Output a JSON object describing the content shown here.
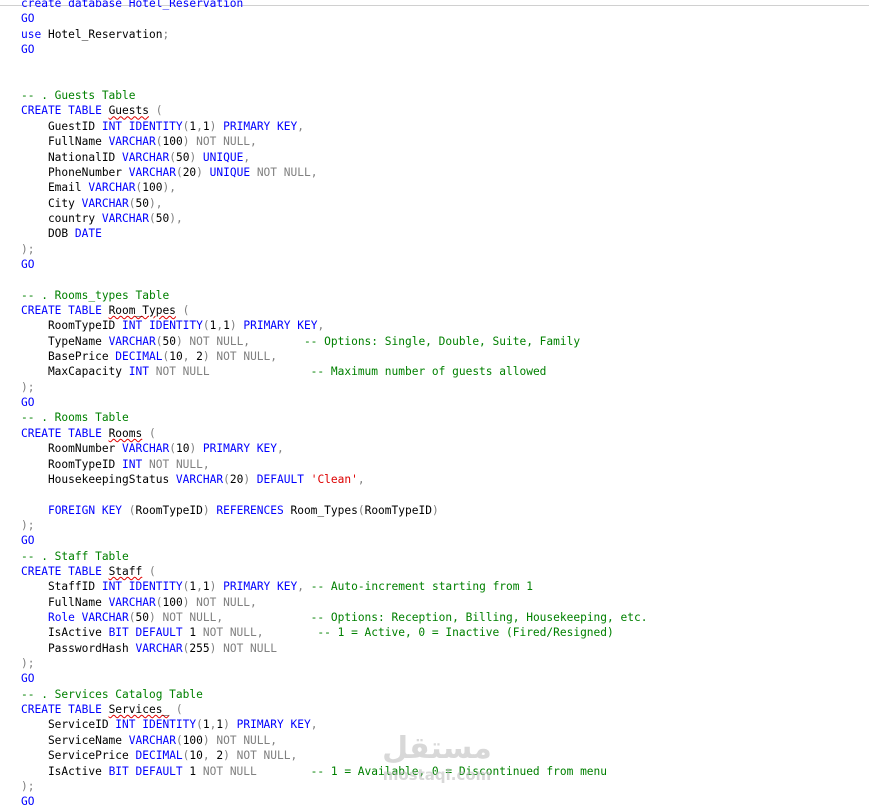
{
  "colors": {
    "keyword": "#0000ff",
    "comment": "#008000",
    "string": "#dd0000",
    "operator": "#808080",
    "identifier": "#000000",
    "squiggle": "#e00000"
  },
  "editor": {
    "lines": [
      [
        [
          "kw",
          "create database Hotel_Reservation"
        ]
      ],
      [
        [
          "kw",
          "GO"
        ]
      ],
      [
        [
          "kw",
          "use"
        ],
        [
          "id",
          " Hotel_Reservation"
        ],
        [
          "op",
          ";"
        ]
      ],
      [
        [
          "kw",
          "GO"
        ]
      ],
      [],
      [],
      [
        [
          "cm",
          "-- . Guests Table"
        ]
      ],
      [
        [
          "kw",
          "CREATE TABLE "
        ],
        [
          "bad",
          "Guests"
        ],
        [
          "op",
          " ("
        ]
      ],
      [
        [
          "id",
          "    GuestID "
        ],
        [
          "kw",
          "INT IDENTITY"
        ],
        [
          "op",
          "("
        ],
        [
          "id",
          "1"
        ],
        [
          "op",
          ","
        ],
        [
          "id",
          "1"
        ],
        [
          "op",
          ") "
        ],
        [
          "kw",
          "PRIMARY KEY"
        ],
        [
          "op",
          ","
        ]
      ],
      [
        [
          "id",
          "    FullName "
        ],
        [
          "kw",
          "VARCHAR"
        ],
        [
          "op",
          "("
        ],
        [
          "id",
          "100"
        ],
        [
          "op",
          ") NOT NULL,"
        ]
      ],
      [
        [
          "id",
          "    NationalID "
        ],
        [
          "kw",
          "VARCHAR"
        ],
        [
          "op",
          "("
        ],
        [
          "id",
          "50"
        ],
        [
          "op",
          ") "
        ],
        [
          "kw",
          "UNIQUE"
        ],
        [
          "op",
          ","
        ]
      ],
      [
        [
          "id",
          "    PhoneNumber "
        ],
        [
          "kw",
          "VARCHAR"
        ],
        [
          "op",
          "("
        ],
        [
          "id",
          "20"
        ],
        [
          "op",
          ") "
        ],
        [
          "kw",
          "UNIQUE"
        ],
        [
          "op",
          " NOT NULL,"
        ]
      ],
      [
        [
          "id",
          "    Email "
        ],
        [
          "kw",
          "VARCHAR"
        ],
        [
          "op",
          "("
        ],
        [
          "id",
          "100"
        ],
        [
          "op",
          "),"
        ]
      ],
      [
        [
          "id",
          "    City "
        ],
        [
          "kw",
          "VARCHAR"
        ],
        [
          "op",
          "("
        ],
        [
          "id",
          "50"
        ],
        [
          "op",
          "),"
        ]
      ],
      [
        [
          "id",
          "    country "
        ],
        [
          "kw",
          "VARCHAR"
        ],
        [
          "op",
          "("
        ],
        [
          "id",
          "50"
        ],
        [
          "op",
          "),"
        ]
      ],
      [
        [
          "id",
          "    DOB "
        ],
        [
          "kw",
          "DATE"
        ]
      ],
      [
        [
          "op",
          ");"
        ]
      ],
      [
        [
          "kw",
          "GO"
        ]
      ],
      [],
      [
        [
          "cm",
          "-- . Rooms_types Table"
        ]
      ],
      [
        [
          "kw",
          "CREATE TABLE "
        ],
        [
          "bad",
          "Room_Types"
        ],
        [
          "op",
          " ("
        ]
      ],
      [
        [
          "id",
          "    RoomTypeID "
        ],
        [
          "kw",
          "INT IDENTITY"
        ],
        [
          "op",
          "("
        ],
        [
          "id",
          "1"
        ],
        [
          "op",
          ","
        ],
        [
          "id",
          "1"
        ],
        [
          "op",
          ") "
        ],
        [
          "kw",
          "PRIMARY KEY"
        ],
        [
          "op",
          ","
        ]
      ],
      [
        [
          "id",
          "    TypeName "
        ],
        [
          "kw",
          "VARCHAR"
        ],
        [
          "op",
          "("
        ],
        [
          "id",
          "50"
        ],
        [
          "op",
          ") NOT NULL,"
        ],
        [
          "id",
          "        "
        ],
        [
          "cm",
          "-- Options: Single, Double, Suite, Family"
        ]
      ],
      [
        [
          "id",
          "    BasePrice "
        ],
        [
          "kw",
          "DECIMAL"
        ],
        [
          "op",
          "("
        ],
        [
          "id",
          "10"
        ],
        [
          "op",
          ", "
        ],
        [
          "id",
          "2"
        ],
        [
          "op",
          ") NOT NULL,"
        ]
      ],
      [
        [
          "id",
          "    MaxCapacity "
        ],
        [
          "kw",
          "INT"
        ],
        [
          "op",
          " NOT NULL"
        ],
        [
          "id",
          "               "
        ],
        [
          "cm",
          "-- Maximum number of guests allowed"
        ]
      ],
      [
        [
          "op",
          ");"
        ]
      ],
      [
        [
          "kw",
          "GO"
        ]
      ],
      [
        [
          "cm",
          "-- . Rooms Table"
        ]
      ],
      [
        [
          "kw",
          "CREATE TABLE "
        ],
        [
          "bad",
          "Rooms"
        ],
        [
          "op",
          " ("
        ]
      ],
      [
        [
          "id",
          "    RoomNumber "
        ],
        [
          "kw",
          "VARCHAR"
        ],
        [
          "op",
          "("
        ],
        [
          "id",
          "10"
        ],
        [
          "op",
          ") "
        ],
        [
          "kw",
          "PRIMARY KEY"
        ],
        [
          "op",
          ","
        ]
      ],
      [
        [
          "id",
          "    RoomTypeID "
        ],
        [
          "kw",
          "INT"
        ],
        [
          "op",
          " NOT NULL,"
        ]
      ],
      [
        [
          "id",
          "    HousekeepingStatus "
        ],
        [
          "kw",
          "VARCHAR"
        ],
        [
          "op",
          "("
        ],
        [
          "id",
          "20"
        ],
        [
          "op",
          ") "
        ],
        [
          "kw",
          "DEFAULT"
        ],
        [
          "id",
          " "
        ],
        [
          "str",
          "'Clean'"
        ],
        [
          "op",
          ","
        ]
      ],
      [],
      [
        [
          "id",
          "    "
        ],
        [
          "kw",
          "FOREIGN KEY"
        ],
        [
          "op",
          " ("
        ],
        [
          "id",
          "RoomTypeID"
        ],
        [
          "op",
          ") "
        ],
        [
          "kw",
          "REFERENCES"
        ],
        [
          "id",
          " Room_Types"
        ],
        [
          "op",
          "("
        ],
        [
          "id",
          "RoomTypeID"
        ],
        [
          "op",
          ")"
        ]
      ],
      [
        [
          "op",
          ");"
        ]
      ],
      [
        [
          "kw",
          "GO"
        ]
      ],
      [
        [
          "cm",
          "-- . Staff Table"
        ]
      ],
      [
        [
          "kw",
          "CREATE TABLE "
        ],
        [
          "bad",
          "Staff"
        ],
        [
          "op",
          " ("
        ]
      ],
      [
        [
          "id",
          "    StaffID "
        ],
        [
          "kw",
          "INT IDENTITY"
        ],
        [
          "op",
          "("
        ],
        [
          "id",
          "1"
        ],
        [
          "op",
          ","
        ],
        [
          "id",
          "1"
        ],
        [
          "op",
          ") "
        ],
        [
          "kw",
          "PRIMARY KEY"
        ],
        [
          "op",
          ", "
        ],
        [
          "cm",
          "-- Auto-increment starting from 1"
        ]
      ],
      [
        [
          "id",
          "    FullName "
        ],
        [
          "kw",
          "VARCHAR"
        ],
        [
          "op",
          "("
        ],
        [
          "id",
          "100"
        ],
        [
          "op",
          ") NOT NULL,"
        ]
      ],
      [
        [
          "id",
          "    "
        ],
        [
          "kw",
          "Role VARCHAR"
        ],
        [
          "op",
          "("
        ],
        [
          "id",
          "50"
        ],
        [
          "op",
          ") NOT NULL,"
        ],
        [
          "id",
          "             "
        ],
        [
          "cm",
          "-- Options: Reception, Billing, Housekeeping, etc."
        ]
      ],
      [
        [
          "id",
          "    IsActive "
        ],
        [
          "kw",
          "BIT DEFAULT"
        ],
        [
          "id",
          " 1"
        ],
        [
          "op",
          " NOT NULL,"
        ],
        [
          "id",
          "        "
        ],
        [
          "cm",
          "-- 1 = Active, 0 = Inactive (Fired/Resigned)"
        ]
      ],
      [
        [
          "id",
          "    PasswordHash "
        ],
        [
          "kw",
          "VARCHAR"
        ],
        [
          "op",
          "("
        ],
        [
          "id",
          "255"
        ],
        [
          "op",
          ") NOT NULL"
        ]
      ],
      [
        [
          "op",
          ");"
        ]
      ],
      [
        [
          "kw",
          "GO"
        ]
      ],
      [
        [
          "cm",
          "-- . Services Catalog Table"
        ]
      ],
      [
        [
          "kw",
          "CREATE TABLE "
        ],
        [
          "bad",
          "Services_"
        ],
        [
          "op",
          " ("
        ]
      ],
      [
        [
          "id",
          "    ServiceID "
        ],
        [
          "kw",
          "INT IDENTITY"
        ],
        [
          "op",
          "("
        ],
        [
          "id",
          "1"
        ],
        [
          "op",
          ","
        ],
        [
          "id",
          "1"
        ],
        [
          "op",
          ") "
        ],
        [
          "kw",
          "PRIMARY KEY"
        ],
        [
          "op",
          ","
        ]
      ],
      [
        [
          "id",
          "    ServiceName "
        ],
        [
          "kw",
          "VARCHAR"
        ],
        [
          "op",
          "("
        ],
        [
          "id",
          "100"
        ],
        [
          "op",
          ") NOT NULL,"
        ]
      ],
      [
        [
          "id",
          "    ServicePrice "
        ],
        [
          "kw",
          "DECIMAL"
        ],
        [
          "op",
          "("
        ],
        [
          "id",
          "10"
        ],
        [
          "op",
          ", "
        ],
        [
          "id",
          "2"
        ],
        [
          "op",
          ") NOT NULL,"
        ]
      ],
      [
        [
          "id",
          "    IsActive "
        ],
        [
          "kw",
          "BIT DEFAULT"
        ],
        [
          "id",
          " 1"
        ],
        [
          "op",
          " NOT NULL"
        ],
        [
          "id",
          "        "
        ],
        [
          "cm",
          "-- 1 = Available, 0 = Discontinued from menu"
        ]
      ],
      [
        [
          "op",
          ");"
        ]
      ],
      [
        [
          "kw",
          "GO"
        ]
      ],
      [
        [
          "mid",
          "   ------------------------------------------------------------------------"
        ]
      ]
    ]
  },
  "watermark": {
    "arabic": "مستقل",
    "latin": "mostaql.com"
  }
}
